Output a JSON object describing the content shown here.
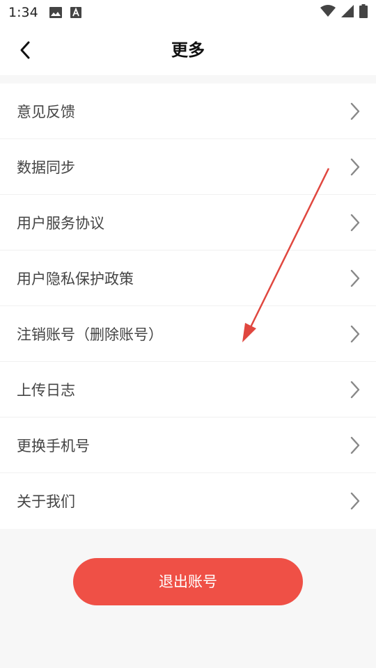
{
  "status_bar": {
    "time": "1:34",
    "icons": [
      "image-icon",
      "a-icon",
      "wifi-icon",
      "signal-icon",
      "battery-icon"
    ]
  },
  "header": {
    "title": "更多",
    "back_icon": "chevron-left-icon"
  },
  "menu": {
    "items": [
      {
        "label": "意见反馈"
      },
      {
        "label": "数据同步"
      },
      {
        "label": "用户服务协议"
      },
      {
        "label": "用户隐私保护政策"
      },
      {
        "label": "注销账号（删除账号）"
      },
      {
        "label": "上传日志"
      },
      {
        "label": "更换手机号"
      },
      {
        "label": "关于我们"
      }
    ]
  },
  "logout": {
    "label": "退出账号"
  },
  "colors": {
    "accent": "#ef5046",
    "annotation_arrow": "#e0473f"
  }
}
